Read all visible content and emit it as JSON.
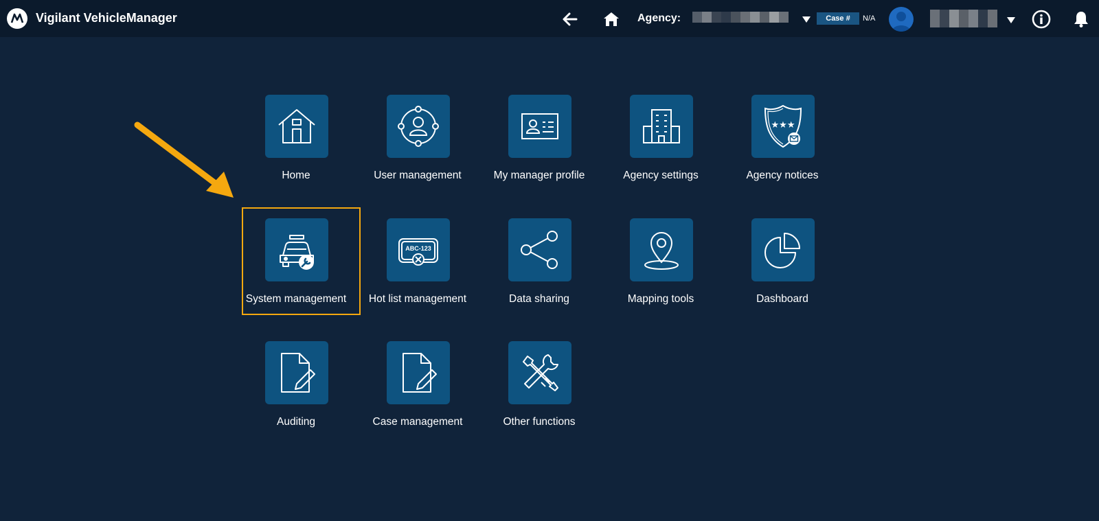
{
  "header": {
    "app_title": "Vigilant VehicleManager",
    "agency_label": "Agency:",
    "case_label": "Case #",
    "case_value": "N/A",
    "icons": [
      "motorola-logo",
      "back-arrow-icon",
      "home-icon",
      "chevron-down-icon",
      "avatar",
      "info-icon",
      "bell-icon"
    ]
  },
  "tiles": [
    {
      "label": "Home",
      "icon": "house-icon"
    },
    {
      "label": "User management",
      "icon": "users-network-icon"
    },
    {
      "label": "My manager profile",
      "icon": "id-card-icon"
    },
    {
      "label": "Agency settings",
      "icon": "building-icon"
    },
    {
      "label": "Agency notices",
      "icon": "shield-notice-icon"
    },
    {
      "label": "System management",
      "icon": "police-car-wrench-icon"
    },
    {
      "label": "Hot list management",
      "icon": "license-plate-icon"
    },
    {
      "label": "Data sharing",
      "icon": "share-icon"
    },
    {
      "label": "Mapping tools",
      "icon": "map-pin-icon"
    },
    {
      "label": "Dashboard",
      "icon": "pie-chart-icon"
    },
    {
      "label": "Auditing",
      "icon": "document-edit-icon"
    },
    {
      "label": "Case management",
      "icon": "document-edit-icon"
    },
    {
      "label": "Other functions",
      "icon": "tools-icon"
    }
  ],
  "plate_text": "ABC-123",
  "annotation": {
    "highlight_color": "#f5a80f",
    "highlighted_tile": "System management"
  },
  "colors": {
    "background": "#10233a",
    "topbar": "#0b1a2c",
    "tile": "#0e5380",
    "case_badge": "#1a5582"
  }
}
